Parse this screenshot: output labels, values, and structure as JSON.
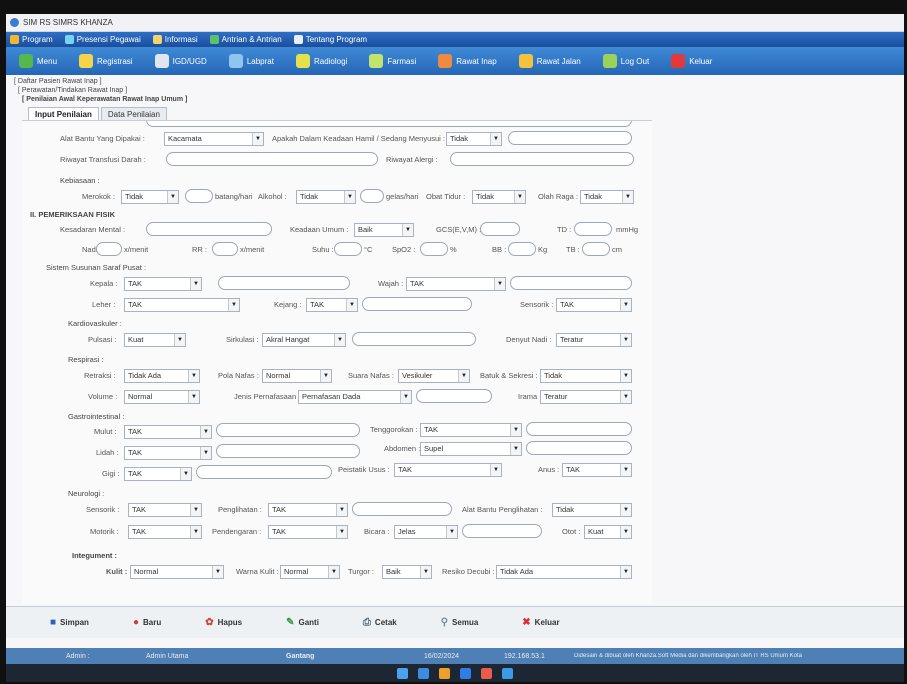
{
  "window_title": "SIM RS SIMRS KHANZA",
  "menu": [
    "Program",
    "Presensi Pegawai",
    "Informasi",
    "Antrian & Antrian",
    "Tentang Program"
  ],
  "toolbar": [
    "Menu",
    "Registrasi",
    "IGD/UGD",
    "Labprat",
    "Radiologi",
    "Farmasi",
    "Rawat Inap",
    "Rawat Jalan",
    "Log Out",
    "Keluar"
  ],
  "breadcrumb": [
    "[ Daftar Pasien Rawat Inap ]",
    "[ Perawatan/Tindakan Rawat Inap ]",
    "[ Penilaian Awal Keperawatan Rawat Inap Umum ]"
  ],
  "tabs": [
    "Input Penilaian",
    "Data Penilaian"
  ],
  "form": {
    "alat_bantu_label": "Alat Bantu Yang Dipakai :",
    "alat_bantu": "Kacamata",
    "hamil_label": "Apakah Dalam Keadaan Hamil / Sedang Menyusui :",
    "hamil": "Tidak",
    "transfusi_label": "Riwayat Transfusi Darah :",
    "alergi_label": "Riwayat Alergi :",
    "kebiasaan": "Kebiasaan :",
    "merokok_label": "Merokok :",
    "merokok": "Tidak",
    "batang": "batang/hari",
    "alkohol_label": "Alkohol :",
    "alkohol": "Tidak",
    "gelas": "gelas/hari",
    "obat_tidur_label": "Obat Tidur :",
    "obat_tidur": "Tidak",
    "olahraga_label": "Olah Raga :",
    "olahraga": "Tidak",
    "section2": "II. PEMERIKSAAN FISIK",
    "kesadaran_label": "Kesadaran Mental :",
    "keadaan_label": "Keadaan Umum :",
    "keadaan": "Baik",
    "gcs_label": "GCS(E,V,M) :",
    "td_label": "TD :",
    "mmhg": "mmHg",
    "nadi_label": "Nadi :",
    "xmenit1": "x/menit",
    "rr_label": "RR :",
    "xmenit2": "x/menit",
    "suhu_label": "Suhu :",
    "celsius": "°C",
    "spo2_label": "SpO2 :",
    "persen": "%",
    "bb_label": "BB :",
    "kg": "Kg",
    "tb_label": "TB :",
    "cm": "cm",
    "saraf": "Sistem Susunan Saraf Pusat :",
    "kepala_label": "Kepala :",
    "kepala": "TAK",
    "wajah_label": "Wajah :",
    "wajah": "TAK",
    "leher_label": "Leher :",
    "leher": "TAK",
    "kejang_label": "Kejang :",
    "kejang": "TAK",
    "sensorik_label": "Sensorik :",
    "sensorik": "TAK",
    "kardio": "Kardiovaskuler :",
    "pulsasi_label": "Pulsasi :",
    "pulsasi": "Kuat",
    "sirkulasi_label": "Sirkulasi :",
    "sirkulasi": "Akral Hangat",
    "denyut_label": "Denyut Nadi :",
    "denyut": "Teratur",
    "respirasi": "Respirasi :",
    "retraksi_label": "Retraksi :",
    "retraksi": "Tidak Ada",
    "pola_label": "Pola Nafas :",
    "pola": "Normal",
    "suara_label": "Suara Nafas :",
    "suara": "Vesikuler",
    "batuk_label": "Batuk & Sekresi :",
    "batuk": "Tidak",
    "volume_label": "Volume :",
    "volume": "Normal",
    "jenis_label": "Jenis Pernafasaan :",
    "jenis": "Pernafasan Dada",
    "irama_label": "Irama :",
    "irama": "Teratur",
    "gastro": "Gastrointestinal :",
    "mulut_label": "Mulut :",
    "mulut": "TAK",
    "tenggorokan_label": "Tenggorokan :",
    "tenggorokan": "TAK",
    "lidah_label": "Lidah :",
    "lidah": "TAK",
    "abdomen_label": "Abdomen :",
    "abdomen": "Supel",
    "gigi_label": "Gigi :",
    "gigi": "TAK",
    "peristatik_label": "Peistatik Usus :",
    "peristatik": "TAK",
    "anus_label": "Anus :",
    "anus": "TAK",
    "neuro": "Neurologi :",
    "n_sensorik_label": "Sensorik :",
    "n_sensorik": "TAK",
    "penglihatan_label": "Penglihatan :",
    "penglihatan": "TAK",
    "alat_penglihatan_label": "Alat Bantu Penglihatan :",
    "alat_penglihatan": "Tidak",
    "motorik_label": "Motorik :",
    "motorik": "TAK",
    "pendengaran_label": "Pendengaran :",
    "pendengaran": "TAK",
    "bicara_label": "Bicara :",
    "bicara": "Jelas",
    "otot_label": "Otot :",
    "otot": "Kuat",
    "integumen": "Integument :",
    "kulit_label": "Kulit :",
    "kulit": "Normal",
    "warna_label": "Warna Kulit :",
    "warna": "Normal",
    "turgor_label": "Turgor :",
    "turgor": "Baik",
    "resiko_label": "Resiko Decubi :",
    "resiko": "Tidak Ada"
  },
  "buttons": [
    "Simpan",
    "Baru",
    "Hapus",
    "Ganti",
    "Cetak",
    "Semua",
    "Keluar"
  ],
  "status": [
    "Admin :",
    "Admin Utama",
    "Gantang",
    "16/02/2024",
    "192.168.53.1",
    "Didesain & dibuat oleh Khanza.Soft Media dan dikembangkan oleh IT RS Umum Kota"
  ]
}
